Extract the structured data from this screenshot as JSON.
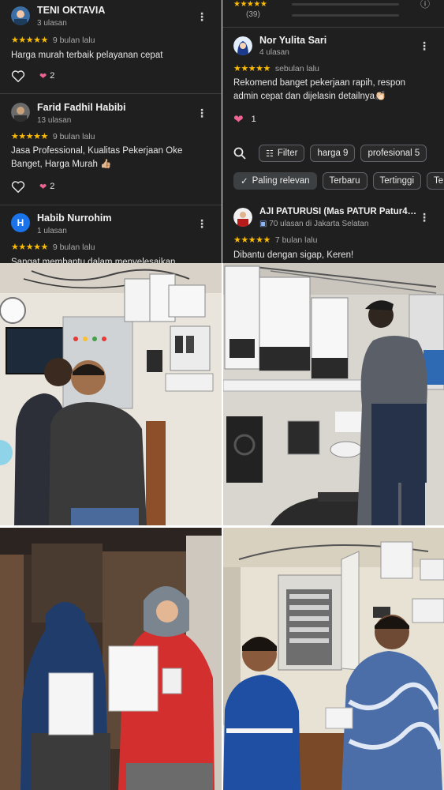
{
  "left_reviews": [
    {
      "name": "TENI OKTAVIA",
      "count": "3 ulasan",
      "stars": "★★★★★",
      "time": "9 bulan lalu",
      "text": "Harga murah terbaik pelayanan cepat",
      "likes": "2"
    },
    {
      "name": "Farid Fadhil Habibi",
      "count": "13 ulasan",
      "stars": "★★★★★",
      "time": "9 bulan lalu",
      "text": "Jasa Professional, Kualitas Pekerjaan Oke Banget, Harga Murah 👍🏼",
      "likes": "2"
    },
    {
      "name": "Habib Nurrohim",
      "count": "1 ulasan",
      "stars": "★★★★★",
      "time": "9 bulan lalu",
      "text": "Sangat membantu dalam menyelesaikan",
      "avatar_letter": "H"
    }
  ],
  "right_top": {
    "stars": "★★★★★",
    "count": "(39)"
  },
  "right_review": {
    "name": "Nor Yulita Sari",
    "count": "4 ulasan",
    "stars": "★★★★★",
    "time": "sebulan lalu",
    "text": "Rekomend banget pekerjaan rapih, respon admin cepat dan dijelasin detailnya👏🏻",
    "likes": "1"
  },
  "filters": {
    "row1": [
      "Filter",
      "harga 9",
      "profesional 5"
    ],
    "row2": [
      "Paling relevan",
      "Terbaru",
      "Tertinggi",
      "Te"
    ]
  },
  "bottom_review": {
    "name": "AJI PATURUSI (Mas PATUR Patur4…",
    "count": "70 ulasan di Jakarta Selatan",
    "stars": "★★★★★",
    "time": "7 bulan lalu",
    "text": "Dibantu dengan sigap, Keren!"
  },
  "colors": {
    "panel_bg": "#1f1f1f",
    "star": "#fbbc04",
    "heart": "#f06292",
    "avatar_blue": "#1a73e8"
  }
}
